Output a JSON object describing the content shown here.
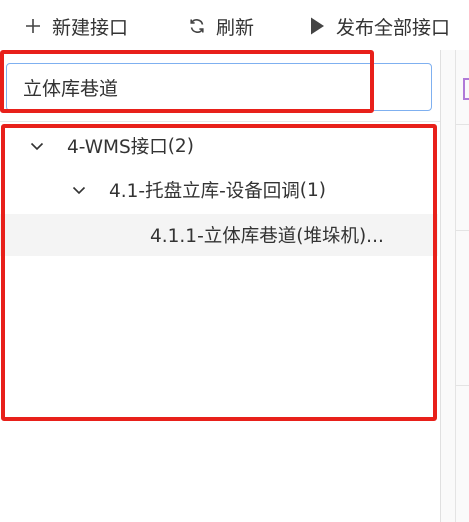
{
  "toolbar": {
    "new_interface_label": "新建接口",
    "refresh_label": "刷新",
    "publish_all_label": "发布全部接口"
  },
  "search": {
    "value": "立体库巷道"
  },
  "tree": {
    "items": [
      {
        "label": "4-WMS接口",
        "count": "(2)",
        "expanded": true
      },
      {
        "label": "4.1-托盘立库-设备回调",
        "count": "(1)",
        "expanded": true
      },
      {
        "label": "4.1.1-立体库巷道(堆垛机)...",
        "count": "",
        "selected": true
      }
    ]
  },
  "colors": {
    "highlight_border": "#e8201a",
    "search_border": "#7fb0f0",
    "selected_row_bg": "#f4f4f4"
  }
}
